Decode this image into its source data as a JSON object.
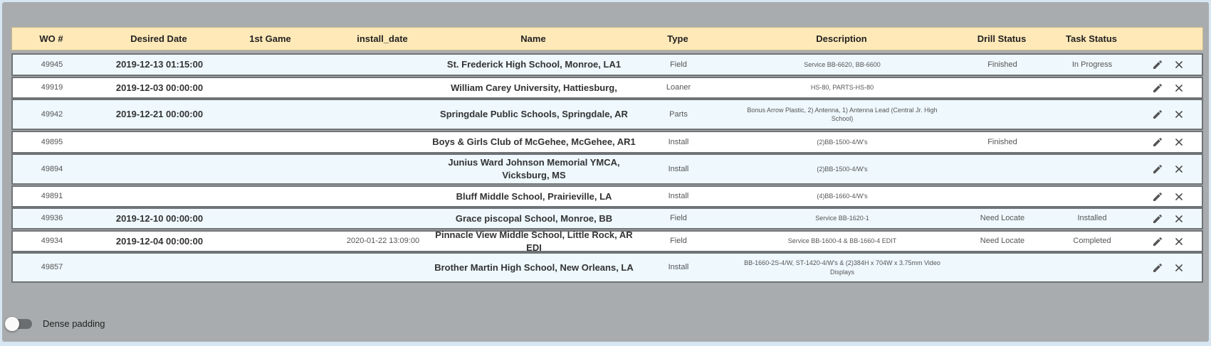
{
  "columns": {
    "wo": "WO #",
    "desired_date": "Desired Date",
    "first_game": "1st Game",
    "install_date": "install_date",
    "name": "Name",
    "type": "Type",
    "description": "Description",
    "drill_status": "Drill Status",
    "task_status": "Task Status"
  },
  "rows": [
    {
      "wo": "49945",
      "desired_date": "2019-12-13 01:15:00",
      "first_game": "",
      "install_date": "",
      "name": "St. Frederick High School, Monroe, LA1",
      "type": "Field",
      "description": "Service BB-6620, BB-6600",
      "drill_status": "Finished",
      "task_status": "In Progress"
    },
    {
      "wo": "49919",
      "desired_date": "2019-12-03 00:00:00",
      "first_game": "",
      "install_date": "",
      "name": "William Carey University, Hattiesburg,",
      "type": "Loaner",
      "description": "HS-80, PARTS-HS-80",
      "drill_status": "",
      "task_status": ""
    },
    {
      "wo": "49942",
      "desired_date": "2019-12-21 00:00:00",
      "first_game": "",
      "install_date": "",
      "name": "Springdale Public Schools, Springdale, AR",
      "type": "Parts",
      "description": "Bonus Arrow Plastic, 2) Antenna, 1) Antenna Lead (Central Jr. High School)",
      "drill_status": "",
      "task_status": ""
    },
    {
      "wo": "49895",
      "desired_date": "",
      "first_game": "",
      "install_date": "",
      "name": "Boys & Girls Club of McGehee, McGehee, AR1",
      "type": "Install",
      "description": "(2)BB-1500-4/W's",
      "drill_status": "Finished",
      "task_status": ""
    },
    {
      "wo": "49894",
      "desired_date": "",
      "first_game": "",
      "install_date": "",
      "name": "Junius Ward Johnson Memorial YMCA, Vicksburg, MS",
      "type": "Install",
      "description": "(2)BB-1500-4/W's",
      "drill_status": "",
      "task_status": ""
    },
    {
      "wo": "49891",
      "desired_date": "",
      "first_game": "",
      "install_date": "",
      "name": "Bluff Middle School, Prairieville, LA",
      "type": "Install",
      "description": "(4)BB-1660-4/W's",
      "drill_status": "",
      "task_status": ""
    },
    {
      "wo": "49936",
      "desired_date": "2019-12-10 00:00:00",
      "first_game": "",
      "install_date": "",
      "name": "Grace piscopal School, Monroe, BB",
      "type": "Field",
      "description": "Service BB-1620-1",
      "drill_status": "Need Locate",
      "task_status": "Installed"
    },
    {
      "wo": "49934",
      "desired_date": "2019-12-04 00:00:00",
      "first_game": "",
      "install_date": "2020-01-22 13:09:00",
      "name": "Pinnacle View Middle School, Little Rock, AR EDI",
      "type": "Field",
      "description": "Service BB-1600-4 & BB-1660-4 EDIT",
      "drill_status": "Need Locate",
      "task_status": "Completed"
    },
    {
      "wo": "49857",
      "desired_date": "",
      "first_game": "",
      "install_date": "",
      "name": "Brother Martin High School, New Orleans, LA",
      "type": "Install",
      "description": "BB-1660-2S-4/W, ST-1420-4/W's & (2)384H x 704W x 3.75mm Video Displays",
      "drill_status": "",
      "task_status": ""
    }
  ],
  "dense_padding": {
    "label": "Dense padding",
    "enabled": false
  },
  "icons": {
    "edit": "pencil-icon",
    "delete": "close-icon"
  },
  "colors": {
    "header_bg": "#ffe9b8",
    "row_alt": "#eef8fd",
    "panel": "#a9acae"
  }
}
